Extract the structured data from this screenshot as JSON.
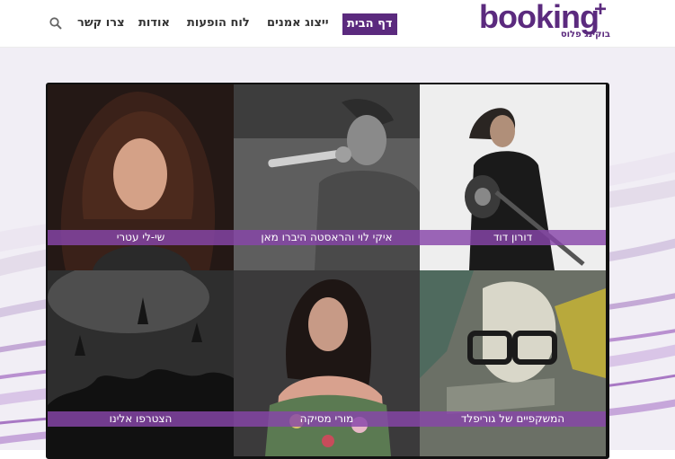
{
  "brand": {
    "logo_word": "booking",
    "logo_plus": "+",
    "logo_sub": "בוקינג פלוס",
    "color": "#5b2a7e"
  },
  "nav": {
    "items": [
      {
        "label": "דף הבית",
        "active": true
      },
      {
        "label": "ייצוג אמנים",
        "active": false
      },
      {
        "label": "לוח הופעות",
        "active": false
      },
      {
        "label": "אודות",
        "active": false
      },
      {
        "label": "צרו קשר",
        "active": false
      }
    ],
    "search_icon": "search-icon"
  },
  "artists": [
    {
      "label": "דורון דוד"
    },
    {
      "label": "איקי לוי והראסטה היברו מאן"
    },
    {
      "label": "שי-לי עטרי"
    },
    {
      "label": "המשקפיים של גוריפלד"
    },
    {
      "label": "מורי מסיקה"
    },
    {
      "label": "הצטרפו אלינו"
    }
  ],
  "label_color": "#8846aa"
}
